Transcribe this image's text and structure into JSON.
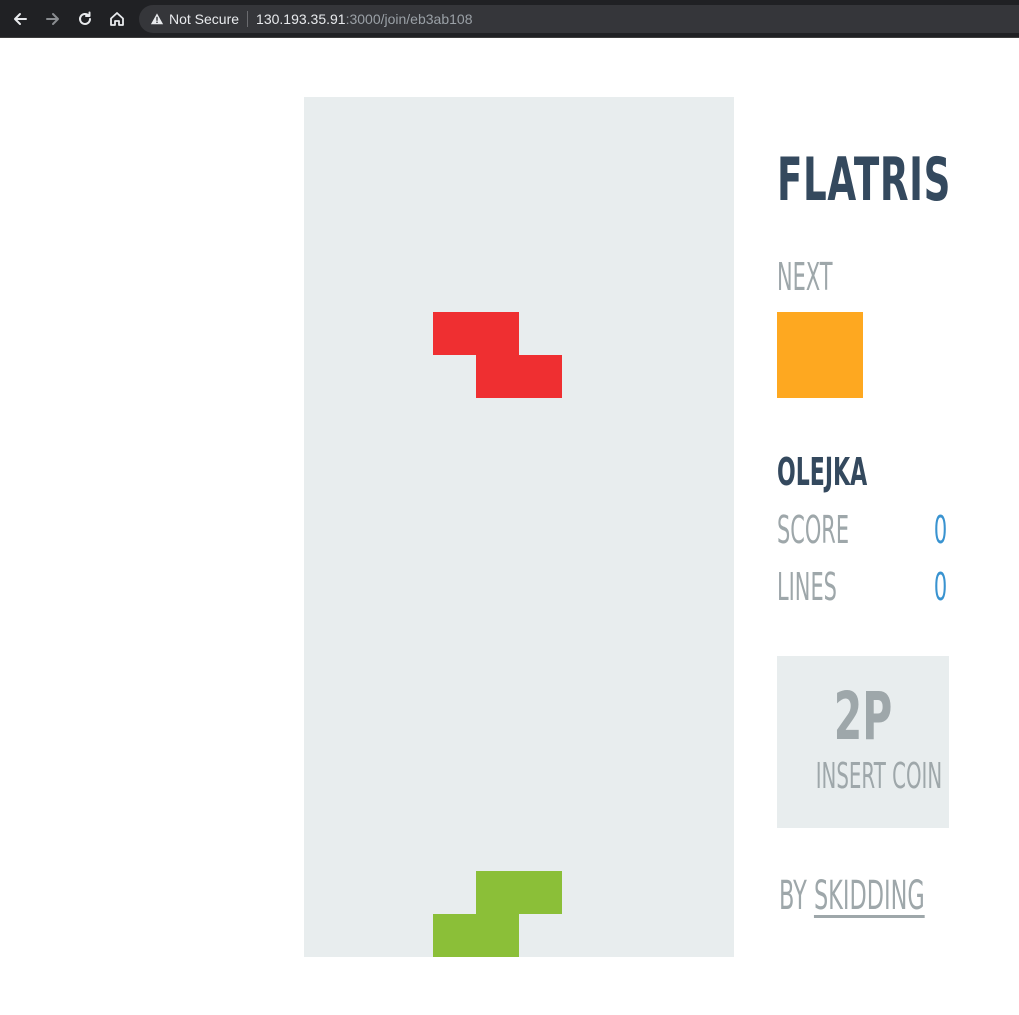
{
  "browser": {
    "security_label": "Not Secure",
    "url_host": "130.193.35.91",
    "url_rest": ":3000/join/eb3ab108"
  },
  "game": {
    "title": "FLATRIS",
    "next_label": "NEXT",
    "next_piece": {
      "shape": "O",
      "color": "#fea820"
    },
    "player": {
      "name": "OLEJKA",
      "score_label": "SCORE",
      "score": "0",
      "lines_label": "LINES",
      "lines": "0"
    },
    "insert_coin": {
      "players": "2P",
      "label": "INSERT COIN"
    },
    "credit": {
      "by": "BY",
      "author": "SKIDDING"
    },
    "well": {
      "cols": 10,
      "rows": 20,
      "background": "#e8edee",
      "active_piece": {
        "shape": "Z",
        "color": "#ef2f31",
        "cells": [
          [
            3,
            5
          ],
          [
            4,
            5
          ],
          [
            4,
            6
          ],
          [
            5,
            6
          ]
        ]
      },
      "settled_blocks": {
        "color": "#8bbf38",
        "cells": [
          [
            4,
            18
          ],
          [
            5,
            18
          ],
          [
            3,
            19
          ],
          [
            4,
            19
          ]
        ]
      }
    },
    "colors": {
      "title": "#34495e",
      "muted": "#9ea7aa",
      "value": "#3993d0"
    }
  }
}
